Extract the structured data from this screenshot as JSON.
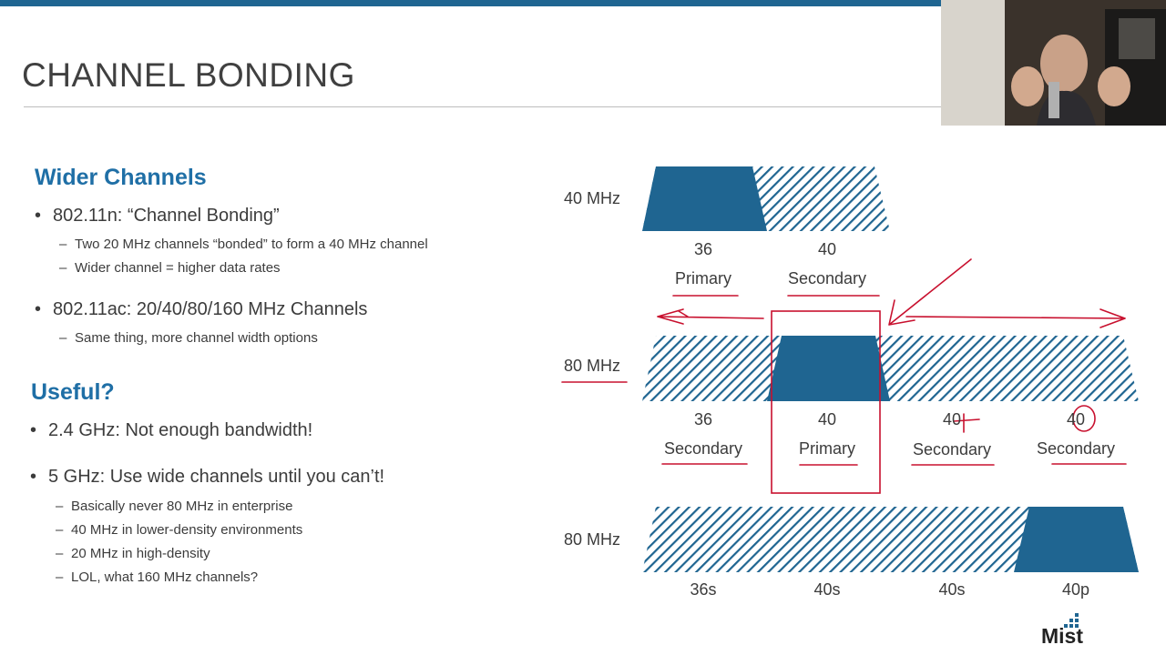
{
  "slide": {
    "title": "CHANNEL BONDING",
    "accent": "#1f6591",
    "heading_color": "#1f6fa6",
    "annotation_color": "#c8102e"
  },
  "left": {
    "wider": {
      "heading": "Wider Channels",
      "b1": "802.11n: “Channel Bonding”",
      "b1_sub1": "Two 20 MHz channels “bonded” to form a 40 MHz channel",
      "b1_sub2": "Wider channel = higher data rates",
      "b2": "802.11ac: 20/40/80/160 MHz Channels",
      "b2_sub1": "Same thing, more channel width options"
    },
    "useful": {
      "heading": "Useful?",
      "b1": "2.4 GHz: Not enough bandwidth!",
      "b2": "5 GHz: Use wide channels until you can’t!",
      "b2_sub1": "Basically never 80 MHz in enterprise",
      "b2_sub2": "40 MHz in lower-density environments",
      "b2_sub3": "20 MHz in high-density",
      "b2_sub4": "LOL, what 160 MHz channels?"
    }
  },
  "diagram": {
    "row1": {
      "width_label": "40 MHz",
      "ch1": "36",
      "role1": "Primary",
      "ch2": "40",
      "role2": "Secondary"
    },
    "row2": {
      "width_label": "80 MHz",
      "ch1": "36",
      "role1": "Secondary",
      "ch2": "40",
      "role2": "Primary",
      "ch3": "40",
      "role3": "Secondary",
      "ch4": "40",
      "role4": "Secondary"
    },
    "row3": {
      "width_label": "80 MHz",
      "ch1": "36s",
      "ch2": "40s",
      "ch3": "40s",
      "ch4": "40p"
    }
  },
  "webcam": {
    "icon": "presenter-video"
  },
  "logo": {
    "text": "Mist"
  }
}
